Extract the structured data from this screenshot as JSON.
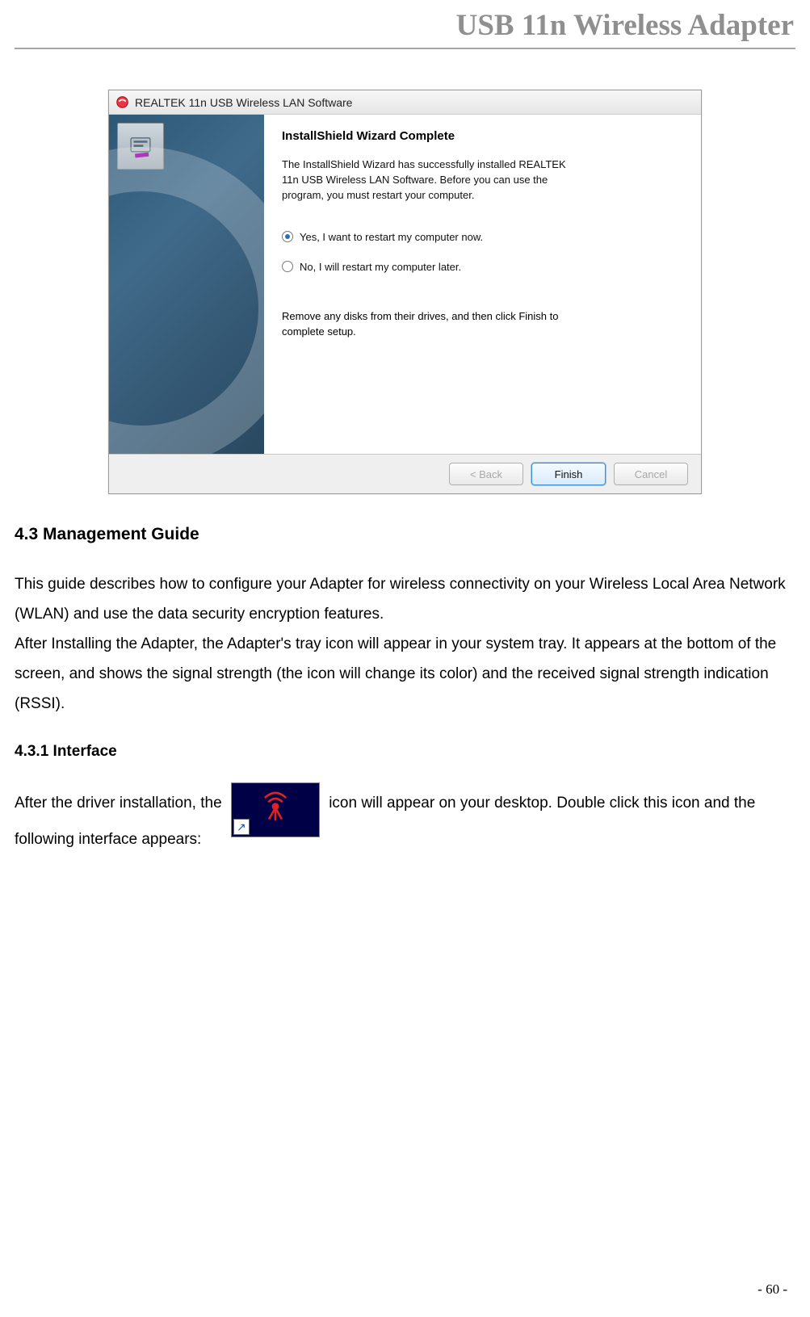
{
  "doc_header": "USB 11n Wireless Adapter",
  "dialog": {
    "title": "REALTEK 11n USB Wireless LAN Software",
    "heading": "InstallShield Wizard Complete",
    "paragraph": "The InstallShield Wizard has successfully installed REALTEK 11n USB Wireless LAN Software.  Before you can use the program, you must restart your computer.",
    "radio_yes": "Yes, I want to restart my computer now.",
    "radio_no": "No, I will restart my computer later.",
    "remove_text": "Remove any disks from their drives, and then click Finish to complete setup.",
    "btn_back": "< Back",
    "btn_finish": "Finish",
    "btn_cancel": "Cancel"
  },
  "sections": {
    "mgmt_heading": "4.3    Management Guide",
    "mgmt_p1": "This guide describes how to configure your Adapter for wireless connectivity on your Wireless Local Area Network (WLAN) and use the data security encryption features.",
    "mgmt_p2": "After Installing the Adapter, the Adapter's tray icon will appear in your system tray. It appears at the bottom of the screen, and shows the signal strength (the icon will change its color) and the received signal strength indication (RSSI).",
    "iface_heading": "4.3.1    Interface",
    "iface_before": "After the driver installation, the ",
    "iface_after": " icon will appear on your desktop. Double click this icon and the following interface appears:"
  },
  "page_number": "- 60 -",
  "shortcut_arrow": "↗"
}
